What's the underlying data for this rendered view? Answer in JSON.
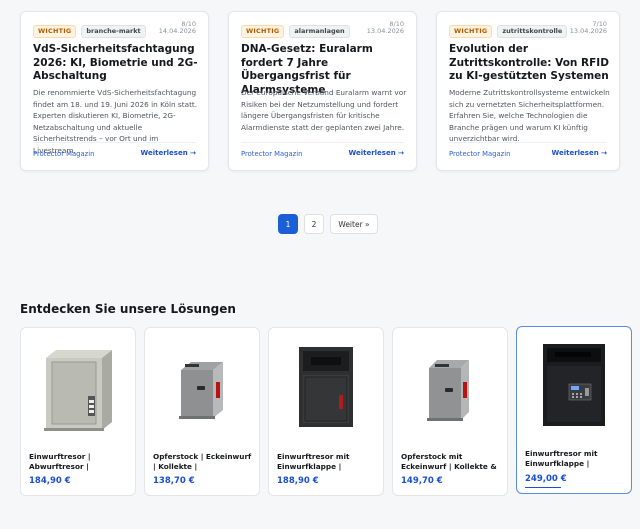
{
  "news": [
    {
      "tag_important": "WICHTIG",
      "tag_category": "branche-markt",
      "rating": "8/10",
      "date": "14.04.2026",
      "title": "VdS-Sicherheitsfachtagung 2026: KI, Biometrie und 2G-Abschaltung",
      "excerpt": "Die renommierte VdS-Sicherheitsfachtagung findet am 18. und 19. Juni 2026 in Köln statt. Experten diskutieren KI, Biometrie, 2G-Netzabschaltung und aktuelle Sicherheitstrends – vor Ort und im Livestream.",
      "source": "Protector Magazin",
      "more": "Weiterlesen →"
    },
    {
      "tag_important": "WICHTIG",
      "tag_category": "alarmanlagen",
      "rating": "8/10",
      "date": "13.04.2026",
      "title": "DNA-Gesetz: Euralarm fordert 7 Jahre Übergangsfrist für Alarmsysteme",
      "excerpt": "Der europäische Verband Euralarm warnt vor Risiken bei der Netzumstellung und fordert längere Übergangsfristen für kritische Alarmdienste statt der geplanten zwei Jahre.",
      "source": "Protector Magazin",
      "more": "Weiterlesen →"
    },
    {
      "tag_important": "WICHTIG",
      "tag_category": "zutrittskontrolle",
      "rating": "7/10",
      "date": "13.04.2026",
      "title": "Evolution der Zutrittskontrolle: Von RFID zu KI-gestützten Systemen",
      "excerpt": "Moderne Zutrittskontrollsysteme entwickeln sich zu vernetzten Sicherheitsplattformen. Erfahren Sie, welche Technologien die Branche prägen und warum KI künftig unverzichtbar wird.",
      "source": "Protector Magazin",
      "more": "Weiterlesen →"
    }
  ],
  "pagination": {
    "page1": "1",
    "page2": "2",
    "next": "Weiter »"
  },
  "solutions": {
    "title": "Entdecken Sie unsere Lösungen",
    "products": [
      {
        "name": "Einwurftresor | Abwurftresor |",
        "price": "184,90 €"
      },
      {
        "name": "Opferstock | Eckeinwurf | Kollekte | Kirchentresor |",
        "price": "138,70 €"
      },
      {
        "name": "Einwurftresor mit Einwurfklappe |",
        "price": "188,90 €"
      },
      {
        "name": "Opferstock mit Eckeinwurf | Kollekte & Kirchentresor…",
        "price": "149,70 €"
      },
      {
        "name": "Einwurftresor mit Einwurfklappe |",
        "price": "249,00 €"
      }
    ]
  },
  "colors": {
    "accent": "#1a5fd6",
    "price": "#1a4fd0",
    "tag_important": "#b35a00"
  }
}
